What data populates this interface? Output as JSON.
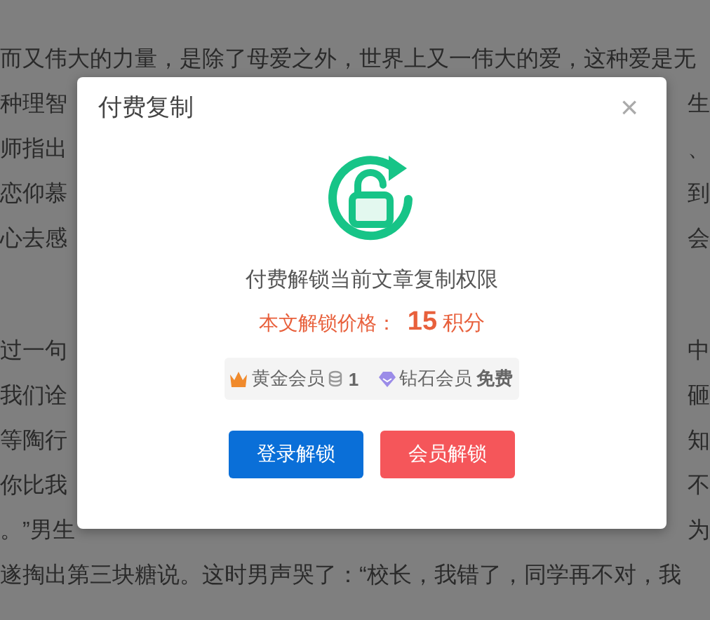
{
  "article": {
    "paragraphs": [
      {
        "lines": [
          {
            "left": "而又伟大的力量，是除了母爱之外，世界上又一伟大的爱，这种爱是无"
          },
          {
            "left": "种理智",
            "right": "生"
          },
          {
            "left": "师指出",
            "right": "、"
          },
          {
            "left": "恋仰慕",
            "right": "到"
          },
          {
            "left": "心去感",
            "right": "会"
          }
        ]
      },
      {
        "lines": [
          {
            "left": "过一句",
            "right": "中"
          },
          {
            "left": "我们诠",
            "right": "砸"
          },
          {
            "left": "等陶行",
            "right": "知"
          },
          {
            "left": "你比我",
            "right": "不"
          },
          {
            "left": "。”男生",
            "right": "为"
          },
          {
            "left": "遂掏出第三块糖说。这时男声哭了：“校长，我错了，同学再不对，我"
          }
        ]
      }
    ]
  },
  "dialog": {
    "title": "付费复制",
    "close": "×",
    "message": "付费解锁当前文章复制权限",
    "price": {
      "label": "本文解锁价格：",
      "amount": "15",
      "unit": "积分"
    },
    "memberships": [
      {
        "kind": "gold",
        "label": "黄金会员",
        "price": "1"
      },
      {
        "kind": "diamond",
        "label": "钻石会员",
        "price": "免费"
      }
    ],
    "buttons": [
      {
        "kind": "primary",
        "label": "登录解锁"
      },
      {
        "kind": "danger",
        "label": "会员解锁"
      }
    ]
  }
}
